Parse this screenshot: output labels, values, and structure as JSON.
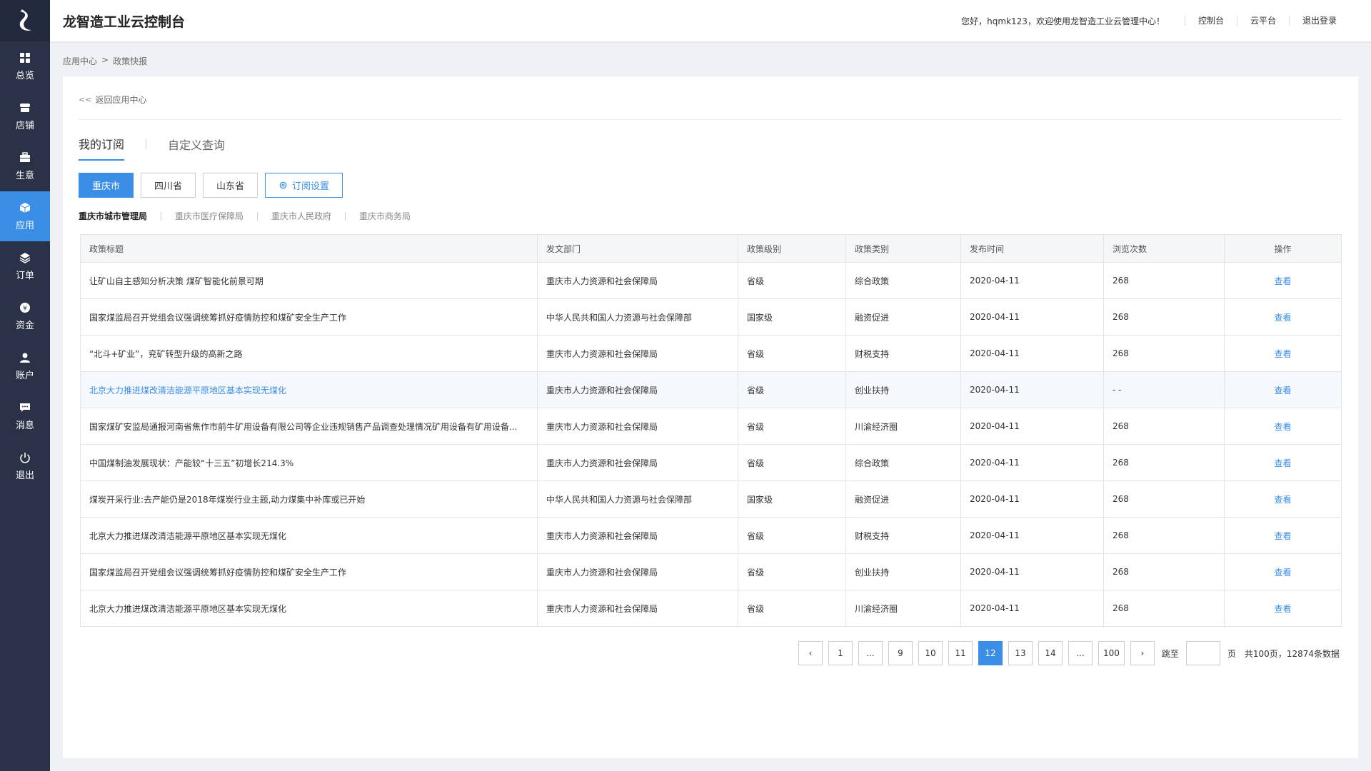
{
  "app": {
    "title": "龙智造工业云控制台"
  },
  "header": {
    "welcome": "您好，hqmk123，欢迎使用龙智造工业云管理中心！",
    "links": [
      "控制台",
      "云平台",
      "退出登录"
    ]
  },
  "sidebar": {
    "items": [
      {
        "label": "总览",
        "icon": "grid-icon"
      },
      {
        "label": "店铺",
        "icon": "store-icon"
      },
      {
        "label": "生意",
        "icon": "briefcase-icon"
      },
      {
        "label": "应用",
        "icon": "cube-icon",
        "active": true
      },
      {
        "label": "订单",
        "icon": "layers-icon"
      },
      {
        "label": "资金",
        "icon": "coin-icon"
      },
      {
        "label": "账户",
        "icon": "user-icon"
      },
      {
        "label": "消息",
        "icon": "message-icon"
      },
      {
        "label": "退出",
        "icon": "power-icon"
      }
    ]
  },
  "breadcrumb": {
    "parent": "应用中心",
    "sep": ">",
    "current": "政策快报"
  },
  "back": {
    "label": "返回应用中心"
  },
  "tabs": [
    {
      "label": "我的订阅",
      "active": true
    },
    {
      "label": "自定义查询"
    }
  ],
  "regions": [
    {
      "label": "重庆市",
      "active": true
    },
    {
      "label": "四川省"
    },
    {
      "label": "山东省"
    }
  ],
  "subscribe_setting": {
    "label": "订阅设置"
  },
  "departments": [
    {
      "label": "重庆市城市管理局",
      "active": true
    },
    {
      "label": "重庆市医疗保障局"
    },
    {
      "label": "重庆市人民政府"
    },
    {
      "label": "重庆市商务局"
    }
  ],
  "table": {
    "columns": [
      "政策标题",
      "发文部门",
      "政策级别",
      "政策类别",
      "发布时间",
      "浏览次数",
      "操作"
    ],
    "rows": [
      [
        "让矿山自主感知分析决策 煤矿智能化前景可期",
        "重庆市人力资源和社会保障局",
        "省级",
        "综合政策",
        "2020-04-11",
        "268",
        "查看"
      ],
      [
        "国家煤监局召开党组会议强调统筹抓好疫情防控和煤矿安全生产工作",
        "中华人民共和国人力资源与社会保障部",
        "国家级",
        "融资促进",
        "2020-04-11",
        "268",
        "查看"
      ],
      [
        "“北斗+矿业”，兖矿转型升级的高新之路",
        "重庆市人力资源和社会保障局",
        "省级",
        "财税支持",
        "2020-04-11",
        "268",
        "查看"
      ],
      [
        "北京大力推进煤改清洁能源平原地区基本实现无煤化",
        "重庆市人力资源和社会保障局",
        "省级",
        "创业扶持",
        "2020-04-11",
        "- -",
        "查看"
      ],
      [
        "国家煤矿安监局通报河南省焦作市前牛矿用设备有限公司等企业违规销售产品调查处理情况矿用设备有矿用设备...",
        "重庆市人力资源和社会保障局",
        "省级",
        "川渝经济圈",
        "2020-04-11",
        "268",
        "查看"
      ],
      [
        "中国煤制油发展现状：产能较“十三五”初增长214.3%",
        "重庆市人力资源和社会保障局",
        "省级",
        "综合政策",
        "2020-04-11",
        "268",
        "查看"
      ],
      [
        "煤炭开采行业:去产能仍是2018年煤炭行业主题,动力煤集中补库或已开始",
        "中华人民共和国人力资源与社会保障部",
        "国家级",
        "融资促进",
        "2020-04-11",
        "268",
        "查看"
      ],
      [
        "北京大力推进煤改清洁能源平原地区基本实现无煤化",
        "重庆市人力资源和社会保障局",
        "省级",
        "财税支持",
        "2020-04-11",
        "268",
        "查看"
      ],
      [
        "国家煤监局召开党组会议强调统筹抓好疫情防控和煤矿安全生产工作",
        "重庆市人力资源和社会保障局",
        "省级",
        "创业扶持",
        "2020-04-11",
        "268",
        "查看"
      ],
      [
        "北京大力推进煤改清洁能源平原地区基本实现无煤化",
        "重庆市人力资源和社会保障局",
        "省级",
        "川渝经济圈",
        "2020-04-11",
        "268",
        "查看"
      ]
    ],
    "highlight_row": 3
  },
  "pagination": {
    "pages": [
      "1",
      "...",
      "9",
      "10",
      "11",
      "12",
      "13",
      "14",
      "...",
      "100"
    ],
    "current": "12",
    "jump_label": "跳至",
    "page_unit": "页",
    "summary": "共100页，12874条数据"
  },
  "colors": {
    "accent": "#3a8ee6",
    "sidebar": "#2b3247"
  }
}
